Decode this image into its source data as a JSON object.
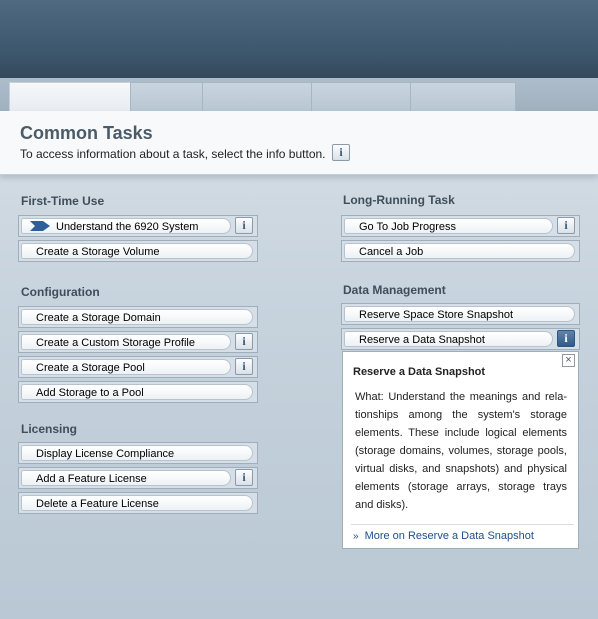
{
  "page": {
    "title": "Common Tasks",
    "help_text": "To access information about a task, select the info button.",
    "info_glyph": "i"
  },
  "sections": {
    "first_time_use": {
      "heading": "First-Time Use",
      "tasks": [
        "Understand the 6920 System",
        "Create a Storage Volume"
      ]
    },
    "configuration": {
      "heading": "Configuration",
      "tasks": [
        "Create a Storage Domain",
        "Create a Custom Storage Profile",
        "Create a Storage Pool",
        "Add Storage to a Pool"
      ]
    },
    "licensing": {
      "heading": "Licensing",
      "tasks": [
        "Display License Compliance",
        "Add a Feature License",
        "Delete a Feature License"
      ]
    },
    "long_running": {
      "heading": "Long-Running Task",
      "tasks": [
        "Go To Job Progress",
        "Cancel a Job"
      ]
    },
    "data_management": {
      "heading": "Data Management",
      "tasks": [
        "Reserve Space Store Snapshot",
        "Reserve a Data Snapshot"
      ]
    }
  },
  "info_panel": {
    "title": "Reserve a Data Snapshot",
    "body": "What: Understand the meanings and rela-tionships among the system's storage elements. These include logical elements (storage domains, volumes, storage pools, virtual disks, and snapshots) and physical elements (storage arrays, storage trays and disks).",
    "link": "More on Reserve a Data Snapshot",
    "link_chevron": "»",
    "close_glyph": "×"
  },
  "colors": {
    "masthead": "#3f5a70",
    "accent_arrow": "#2f5f9a",
    "link": "#1e4f8a",
    "info_active": "#2f5b8a"
  }
}
